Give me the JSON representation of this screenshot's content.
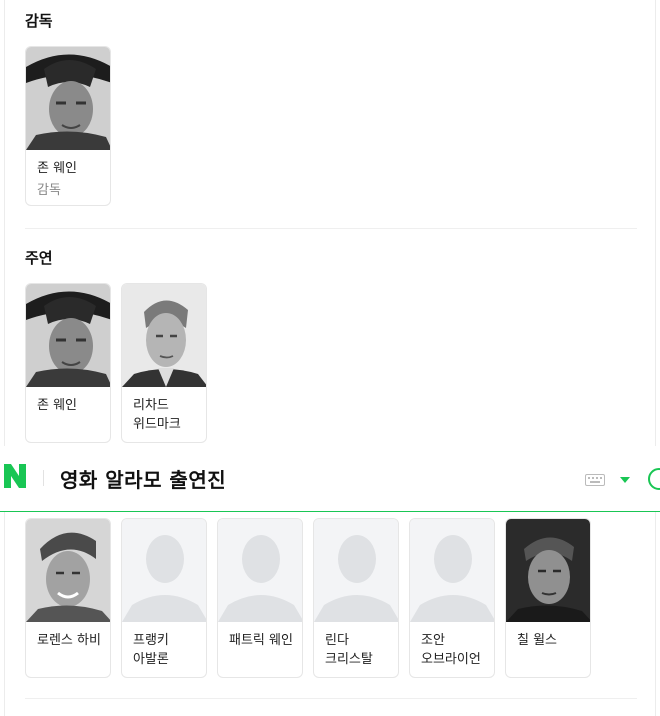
{
  "sections": {
    "director_title": "감독",
    "lead_title": "주연"
  },
  "director": [
    {
      "name": "존 웨인",
      "role": "감독",
      "photo": "person-photo"
    }
  ],
  "leads": [
    {
      "name": "존 웨인",
      "photo": "person-photo"
    },
    {
      "name": "리차드 위드마크",
      "photo": "person-photo"
    }
  ],
  "header": {
    "logo": "naver-logo",
    "title": "영화 알라모 출연진",
    "keyboard_icon": "keyboard-icon",
    "dropdown_icon": "caret-down-icon",
    "accent": "#19c654"
  },
  "cast": [
    {
      "name": "로렌스 하비",
      "photo": "person-photo"
    },
    {
      "name": "프랭키 아발론",
      "photo": "placeholder-icon"
    },
    {
      "name": "패트릭 웨인",
      "photo": "placeholder-icon"
    },
    {
      "name": "린다 크리스탈",
      "photo": "placeholder-icon"
    },
    {
      "name": "조안 오브라이언",
      "photo": "placeholder-icon"
    },
    {
      "name": "칠 윌스",
      "photo": "person-photo"
    }
  ]
}
